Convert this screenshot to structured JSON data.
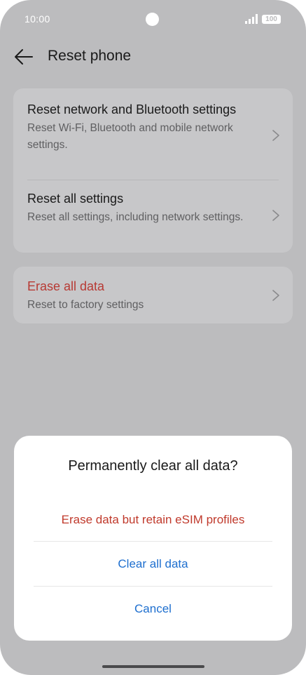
{
  "status_bar": {
    "time": "10:00",
    "battery": "100",
    "signal_icon": "signal-icon",
    "camera_icon": "camera-cutout-icon"
  },
  "header": {
    "back_icon": "arrow-left-icon",
    "title": "Reset phone"
  },
  "settings": {
    "items": [
      {
        "title": "Reset network and Bluetooth settings",
        "subtitle": "Reset Wi-Fi, Bluetooth and mobile network settings.",
        "icon": "chevron-right-icon"
      },
      {
        "title": "Reset all settings",
        "subtitle": "Reset all settings, including network settings.",
        "icon": "chevron-right-icon"
      },
      {
        "title": "Erase all data",
        "subtitle": "Reset to factory settings",
        "icon": "chevron-right-icon"
      }
    ],
    "erase_color": "#b73a34"
  },
  "dialog": {
    "title": "Permanently clear all data?",
    "options": [
      {
        "label": "Erase data but retain eSIM profiles",
        "color": "#c0392b"
      },
      {
        "label": "Clear all data",
        "color": "#1e6fcf"
      },
      {
        "label": "Cancel",
        "color": "#1e6fcf"
      }
    ]
  }
}
